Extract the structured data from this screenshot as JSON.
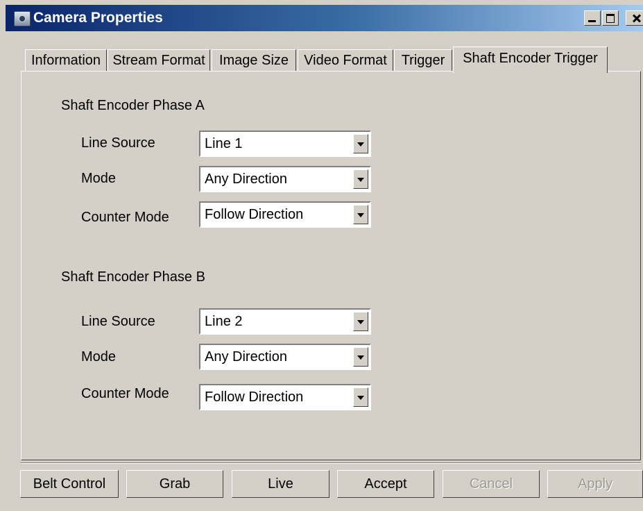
{
  "window": {
    "title": "Camera Properties",
    "controls": {
      "minimize": "minimize",
      "maximize": "maximize",
      "close": "close"
    }
  },
  "tabs": [
    {
      "label": "Information",
      "active": false
    },
    {
      "label": "Stream Format",
      "active": false
    },
    {
      "label": "Image Size",
      "active": false
    },
    {
      "label": "Video Format",
      "active": false
    },
    {
      "label": "Trigger",
      "active": false
    },
    {
      "label": "Shaft Encoder Trigger",
      "active": true
    }
  ],
  "phase_a": {
    "title": "Shaft Encoder Phase A",
    "line_source": {
      "label": "Line Source",
      "value": "Line 1"
    },
    "mode": {
      "label": "Mode",
      "value": "Any Direction"
    },
    "counter_mode": {
      "label": "Counter Mode",
      "value": "Follow Direction"
    }
  },
  "phase_b": {
    "title": "Shaft Encoder Phase B",
    "line_source": {
      "label": "Line Source",
      "value": "Line 2"
    },
    "mode": {
      "label": "Mode",
      "value": "Any Direction"
    },
    "counter_mode": {
      "label": "Counter Mode",
      "value": "Follow Direction"
    }
  },
  "buttons": {
    "belt_control": "Belt Control",
    "grab": "Grab",
    "live": "Live",
    "accept": "Accept",
    "cancel": "Cancel",
    "apply": "Apply"
  },
  "colors": {
    "titlebar_start": "#0a246a",
    "titlebar_end": "#a6caf0",
    "face": "#d4d0c8",
    "disabled_text": "#9c9a95"
  }
}
